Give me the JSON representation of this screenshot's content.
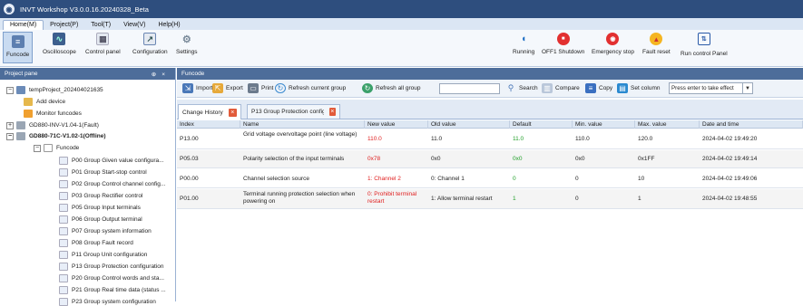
{
  "app": {
    "title": "INVT Workshop V3.0.0.16.20240328_Beta"
  },
  "menu": [
    {
      "label": "Home(M)",
      "active": true
    },
    {
      "label": "Project(P)",
      "active": false
    },
    {
      "label": "Tool(T)",
      "active": false
    },
    {
      "label": "View(V)",
      "active": false
    },
    {
      "label": "Help(H)",
      "active": false
    }
  ],
  "ribbon": {
    "left": [
      "Funcode",
      "Oscilloscope",
      "Control panel",
      "Configuration",
      "Settings"
    ],
    "right": [
      "Running",
      "OFF1 Shutdown",
      "Emergency stop",
      "Fault reset",
      "Run control Panel"
    ]
  },
  "project_pane": {
    "title": "Project pane",
    "tree": [
      {
        "label": "tempProject_202404021635",
        "expander": "−"
      },
      {
        "label": "Add device"
      },
      {
        "label": "Monitor funcodes"
      },
      {
        "label": "GD880-INV-V1.04-1(Fault)",
        "expander": "+"
      },
      {
        "label": "GD880-71C-V1.02-1(Offline)",
        "expander": "−",
        "bold": true
      },
      {
        "label": "Funcode",
        "expander": "−"
      },
      {
        "label": "P00 Group Given value configura..."
      },
      {
        "label": "P01 Group Start-stop control"
      },
      {
        "label": "P02 Group Control channel config..."
      },
      {
        "label": "P03 Group Rectifier control"
      },
      {
        "label": "P05 Group Input terminals"
      },
      {
        "label": "P06 Group Output terminal"
      },
      {
        "label": "P07 Group system information"
      },
      {
        "label": "P08 Group Fault record"
      },
      {
        "label": "P11 Group Unit configuration"
      },
      {
        "label": "P13 Group Protection configuration"
      },
      {
        "label": "P20 Group Control words and sta..."
      },
      {
        "label": "P21 Group Real time data (status ..."
      },
      {
        "label": "P23 Group system configuration"
      }
    ]
  },
  "funcode": {
    "title": "Funcode",
    "toolbar": {
      "import": "Import",
      "export": "Export",
      "print": "Print",
      "refresh_current": "Refresh current group",
      "refresh_all": "Refresh all group",
      "search_value": "",
      "search": "Search",
      "compare": "Compare",
      "copy": "Copy",
      "set_column": "Set column",
      "effect_select": "Press enter to take effect"
    },
    "tabs": [
      "Change History",
      "P13 Group Protection configuratic"
    ],
    "columns": [
      "Index",
      "Name",
      "New value",
      "Old value",
      "Default",
      "Min. value",
      "Max. value",
      "Date and time"
    ],
    "rows": [
      {
        "index": "P13.00",
        "name": "Grid voltage overvoltage point (line voltage)",
        "new": "110.0",
        "old": "11.0",
        "default": "11.0",
        "min": "110.0",
        "max": "120.0",
        "datetime": "2024-04-02 19:49:20"
      },
      {
        "index": "P05.03",
        "name": "Polarity selection of the input terminals",
        "new": "0x78",
        "old": "0x0",
        "default": "0x0",
        "min": "0x0",
        "max": "0x1FF",
        "datetime": "2024-04-02 19:49:14"
      },
      {
        "index": "P00.00",
        "name": "Channel selection source",
        "new": "1: Channel 2",
        "old": "0: Channel 1",
        "default": "0",
        "min": "0",
        "max": "10",
        "datetime": "2024-04-02 19:49:06"
      },
      {
        "index": "P01.00",
        "name": "Terminal running protection selection when powering on",
        "new": "0: Prohibit terminal restart",
        "old": "1: Allow terminal restart",
        "default": "1",
        "min": "0",
        "max": "1",
        "datetime": "2024-04-02 19:48:55"
      }
    ]
  }
}
